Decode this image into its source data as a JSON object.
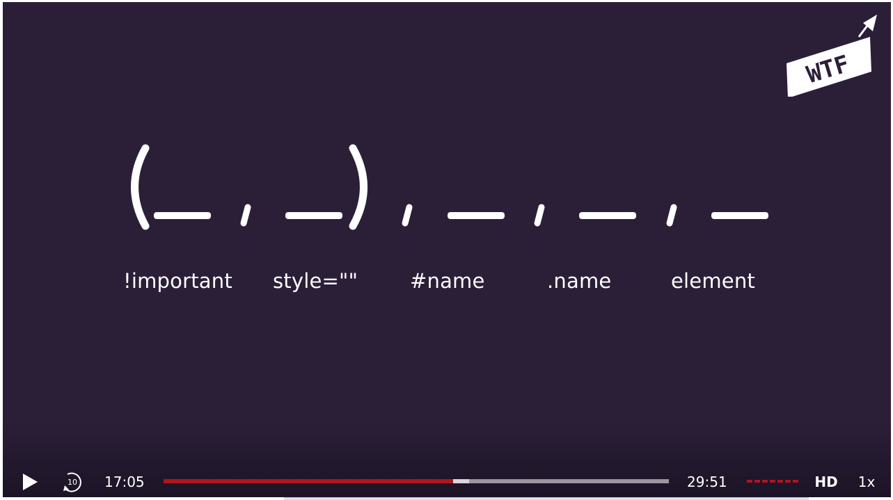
{
  "slide": {
    "labels": [
      "!important",
      "style=\"\"",
      "#name",
      ".name",
      "element"
    ]
  },
  "logo": {
    "text": "WTF",
    "color": "#ffffff"
  },
  "controls": {
    "current_time": "17:05",
    "total_time": "29:51",
    "progress_fraction": 0.573,
    "buffered_fraction": 0.605,
    "rewind_seconds": "10",
    "hd_label": "HD",
    "speed_label": "1x",
    "icons": {
      "play": "play-icon",
      "rewind": "rewind-10-icon",
      "volume": "volume-bar-icon"
    }
  },
  "colors": {
    "background": "#2b1f38",
    "accent": "#b0151d",
    "track": "#9b96a0",
    "text": "#ffffff"
  }
}
